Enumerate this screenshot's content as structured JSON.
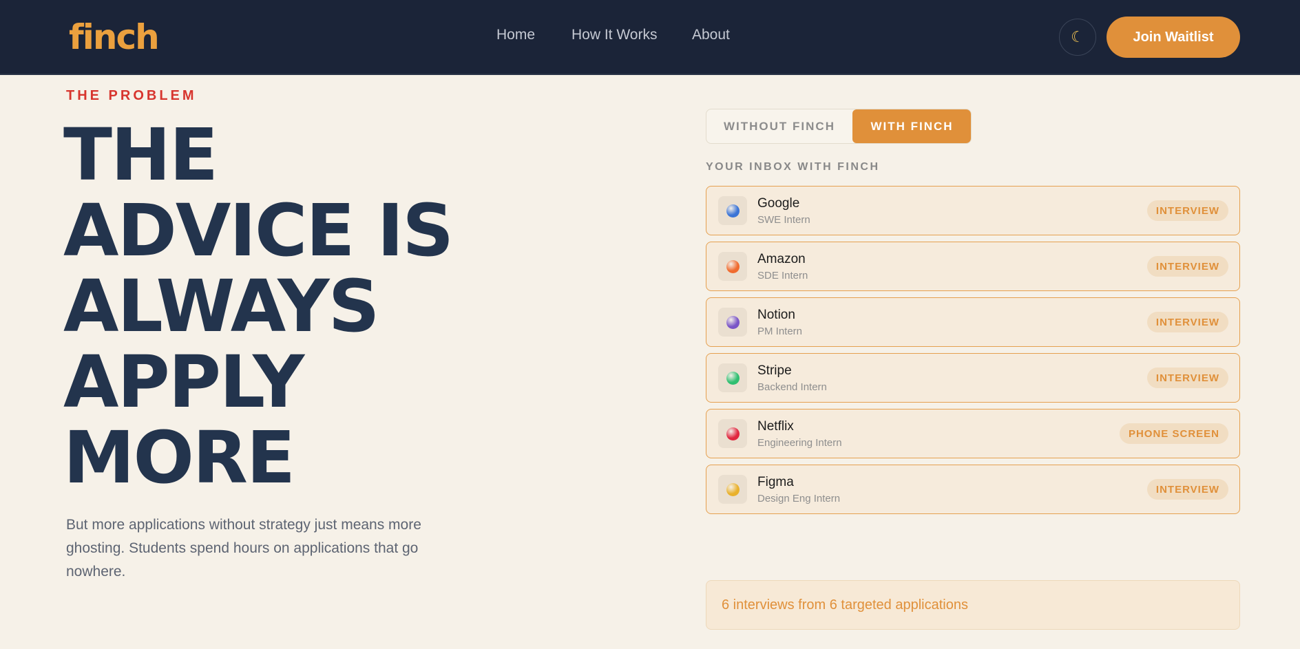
{
  "header": {
    "logo": "finch",
    "nav": [
      "Home",
      "How It Works",
      "About"
    ],
    "theme_icon": "☾",
    "join_label": "Join Waitlist"
  },
  "hero": {
    "eyebrow": "THE PROBLEM",
    "headline": [
      "THE",
      "ADVICE IS",
      "ALWAYS",
      "APPLY",
      "MORE"
    ],
    "subtext": "But more applications without strategy just means more ghosting. Students spend hours on applications that go nowhere."
  },
  "toggle": {
    "options": [
      "WITHOUT FINCH",
      "WITH FINCH"
    ],
    "selected": "WITH FINCH"
  },
  "inbox": {
    "label": "YOUR INBOX WITH FINCH",
    "items": [
      {
        "company": "Google",
        "role": "SWE Intern",
        "status": "INTERVIEW",
        "color": "#3b74d6"
      },
      {
        "company": "Amazon",
        "role": "SDE Intern",
        "status": "INTERVIEW",
        "color": "#f06b2f"
      },
      {
        "company": "Notion",
        "role": "PM Intern",
        "status": "INTERVIEW",
        "color": "#7a55c7"
      },
      {
        "company": "Stripe",
        "role": "Backend Intern",
        "status": "INTERVIEW",
        "color": "#2fbf71"
      },
      {
        "company": "Netflix",
        "role": "Engineering Intern",
        "status": "PHONE SCREEN",
        "color": "#e0273f"
      },
      {
        "company": "Figma",
        "role": "Design Eng Intern",
        "status": "INTERVIEW",
        "color": "#e9b12c"
      }
    ]
  },
  "summary": "6 interviews from 6 targeted applications",
  "colors": {
    "accent": "#e0903a",
    "header_bg": "#1b2438",
    "headline": "#23344d",
    "eyebrow": "#d7352e",
    "page_bg": "#f6f1e8"
  }
}
